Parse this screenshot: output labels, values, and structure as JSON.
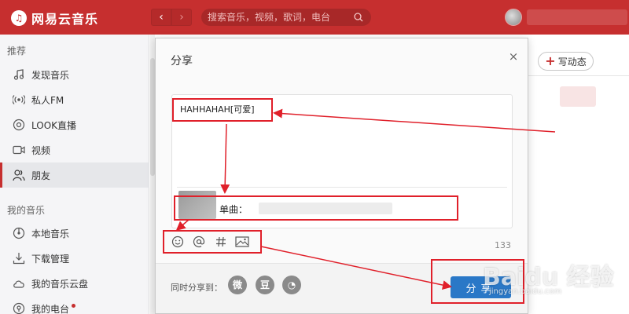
{
  "app": {
    "name": "网易云音乐",
    "logo_glyph": "♫"
  },
  "topbar": {
    "back": "‹",
    "forward": "›",
    "search_placeholder": "搜索音乐，视频，歌词，电台"
  },
  "sidebar": {
    "section_recommend": "推荐",
    "items": [
      {
        "label": "发现音乐",
        "icon": "music-note-icon"
      },
      {
        "label": "私人FM",
        "icon": "radio-icon"
      },
      {
        "label": "LOOK直播",
        "icon": "live-icon"
      },
      {
        "label": "视频",
        "icon": "video-icon"
      },
      {
        "label": "朋友",
        "icon": "friends-icon"
      }
    ],
    "section_my_music": "我的音乐",
    "my_items": [
      {
        "label": "本地音乐",
        "icon": "disc-icon"
      },
      {
        "label": "下载管理",
        "icon": "download-icon"
      },
      {
        "label": "我的音乐云盘",
        "icon": "cloud-icon"
      },
      {
        "label": "我的电台",
        "icon": "podcast-icon"
      }
    ],
    "active_item": "朋友"
  },
  "main": {
    "write_button": "写动态"
  },
  "modal": {
    "title": "分享",
    "close": "×",
    "editor_text": "HAHHAHAH[可爱]",
    "attachment_label": "单曲：",
    "tools": [
      "emoji-icon",
      "mention-icon",
      "hashtag-icon",
      "image-icon"
    ],
    "char_count": "133",
    "footer_label": "同时分享到：",
    "sns": [
      {
        "name": "weibo",
        "glyph": "微"
      },
      {
        "name": "douban",
        "glyph": "豆"
      },
      {
        "name": "qzone",
        "glyph": "◔"
      }
    ],
    "share_button": "分享"
  },
  "watermark": {
    "text": "Baidu 经验",
    "sub": "jingyan.baidu.com"
  },
  "colors": {
    "brand": "#c62f2f",
    "share_button": "#2a78c7",
    "annotation": "#e0202a"
  }
}
